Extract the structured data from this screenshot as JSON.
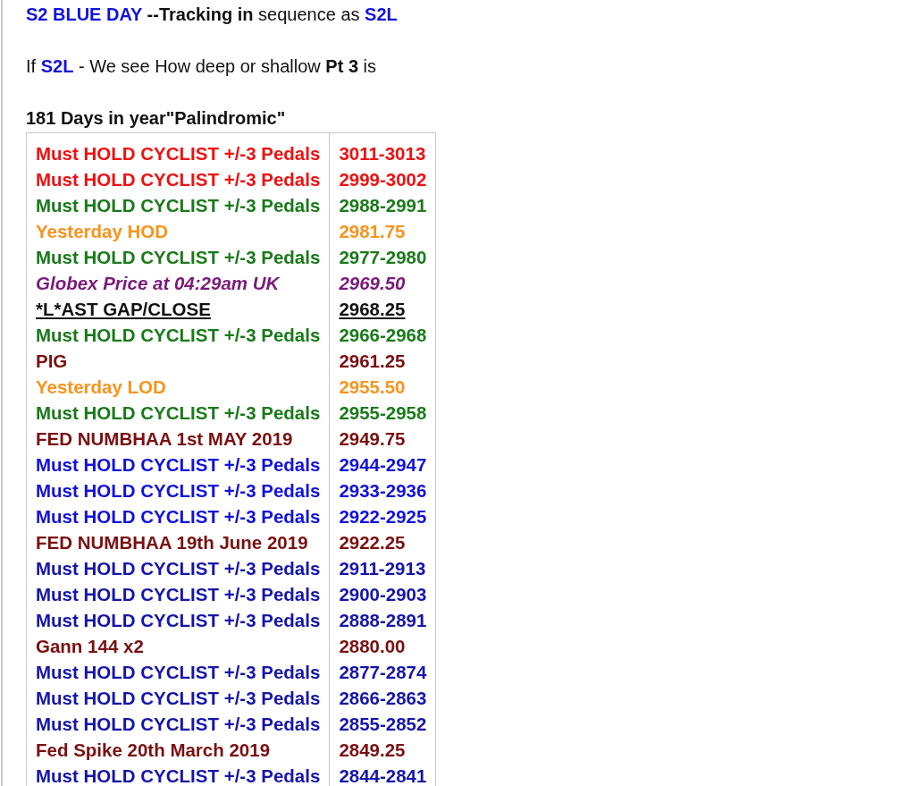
{
  "lines": [
    {
      "segments": [
        {
          "text": "S2 BLUE DAY",
          "kind": "highlight"
        },
        {
          "text": " --Tracking in",
          "kind": "bold"
        },
        {
          "text": " sequence as ",
          "kind": "plain"
        },
        {
          "text": "S2L",
          "kind": "highlight"
        }
      ]
    },
    {
      "segments": [
        {
          "text": "If ",
          "kind": "plain"
        },
        {
          "text": "S2L",
          "kind": "highlight"
        },
        {
          "text": " - We see How deep or shallow ",
          "kind": "plain"
        },
        {
          "text": "Pt 3",
          "kind": "bold"
        },
        {
          "text": " is",
          "kind": "plain"
        }
      ]
    },
    {
      "segments": [
        {
          "text": "181 Days in year\"Palindromic\"",
          "kind": "bold"
        }
      ]
    }
  ],
  "table": {
    "rows": [
      {
        "label": "Must HOLD CYCLIST +/-3 Pedals",
        "value": "3011-3013",
        "color": "#ee1111",
        "kind": "plain"
      },
      {
        "label": "Must HOLD CYCLIST +/-3 Pedals",
        "value": "2999-3002",
        "color": "#ee1111",
        "kind": "plain"
      },
      {
        "label": "Must HOLD CYCLIST +/-3 Pedals",
        "value": "2988-2991",
        "color": "#1a7a1a",
        "kind": "plain"
      },
      {
        "label": "Yesterday HOD",
        "value": "2981.75",
        "color": "#f7941d",
        "kind": "plain"
      },
      {
        "label": "Must HOLD CYCLIST +/-3 Pedals",
        "value": "2977-2980",
        "color": "#1a7a1a",
        "kind": "plain"
      },
      {
        "label": "Globex Price at 04:29am UK",
        "value": "2969.50",
        "color": "#7a1a7a",
        "kind": "italic"
      },
      {
        "label": "*L*AST GAP/CLOSE",
        "value": "2968.25",
        "color": "#111111",
        "kind": "underlined"
      },
      {
        "label": "Must HOLD CYCLIST +/-3 Pedals",
        "value": "2966-2968",
        "color": "#1a7a1a",
        "kind": "plain"
      },
      {
        "label": "PIG",
        "value": "2961.25",
        "color": "#7a1010",
        "kind": "plain"
      },
      {
        "label": "Yesterday LOD",
        "value": "2955.50",
        "color": "#f7941d",
        "kind": "plain"
      },
      {
        "label": "Must HOLD CYCLIST +/-3 Pedals",
        "value": "2955-2958",
        "color": "#1a7a1a",
        "kind": "plain"
      },
      {
        "label": "FED NUMBHAA 1st MAY 2019",
        "value": "2949.75",
        "color": "#7a1010",
        "kind": "plain"
      },
      {
        "label": "Must HOLD CYCLIST +/-3 Pedals",
        "value": "2944-2947",
        "color": "#1111dd",
        "kind": "plain"
      },
      {
        "label": "Must HOLD CYCLIST +/-3 Pedals",
        "value": "2933-2936",
        "color": "#1111dd",
        "kind": "plain"
      },
      {
        "label": "Must HOLD CYCLIST +/-3 Pedals",
        "value": "2922-2925",
        "color": "#1111dd",
        "kind": "plain"
      },
      {
        "label": "FED NUMBHAA 19th June 2019",
        "value": "2922.25",
        "color": "#7a1010",
        "kind": "plain"
      },
      {
        "label": "Must HOLD CYCLIST +/-3 Pedals",
        "value": "2911-2913",
        "color": "#1515aa",
        "kind": "plain"
      },
      {
        "label": "Must HOLD CYCLIST +/-3 Pedals",
        "value": "2900-2903",
        "color": "#1515aa",
        "kind": "plain"
      },
      {
        "label": "Must HOLD CYCLIST +/-3 Pedals",
        "value": "2888-2891",
        "color": "#1515aa",
        "kind": "plain"
      },
      {
        "label": "Gann 144 x2",
        "value": "2880.00",
        "color": "#7a1010",
        "kind": "plain"
      },
      {
        "label": "Must HOLD CYCLIST +/-3 Pedals",
        "value": "2877-2874",
        "color": "#1515aa",
        "kind": "plain"
      },
      {
        "label": "Must HOLD CYCLIST +/-3 Pedals",
        "value": "2866-2863",
        "color": "#1515aa",
        "kind": "plain"
      },
      {
        "label": "Must HOLD CYCLIST +/-3 Pedals",
        "value": "2855-2852",
        "color": "#1515aa",
        "kind": "plain"
      },
      {
        "label": "Fed Spike 20th March 2019",
        "value": "2849.25",
        "color": "#7a1010",
        "kind": "plain"
      },
      {
        "label": "Must HOLD CYCLIST +/-3 Pedals",
        "value": "2844-2841",
        "color": "#1515aa",
        "kind": "plain"
      }
    ]
  }
}
